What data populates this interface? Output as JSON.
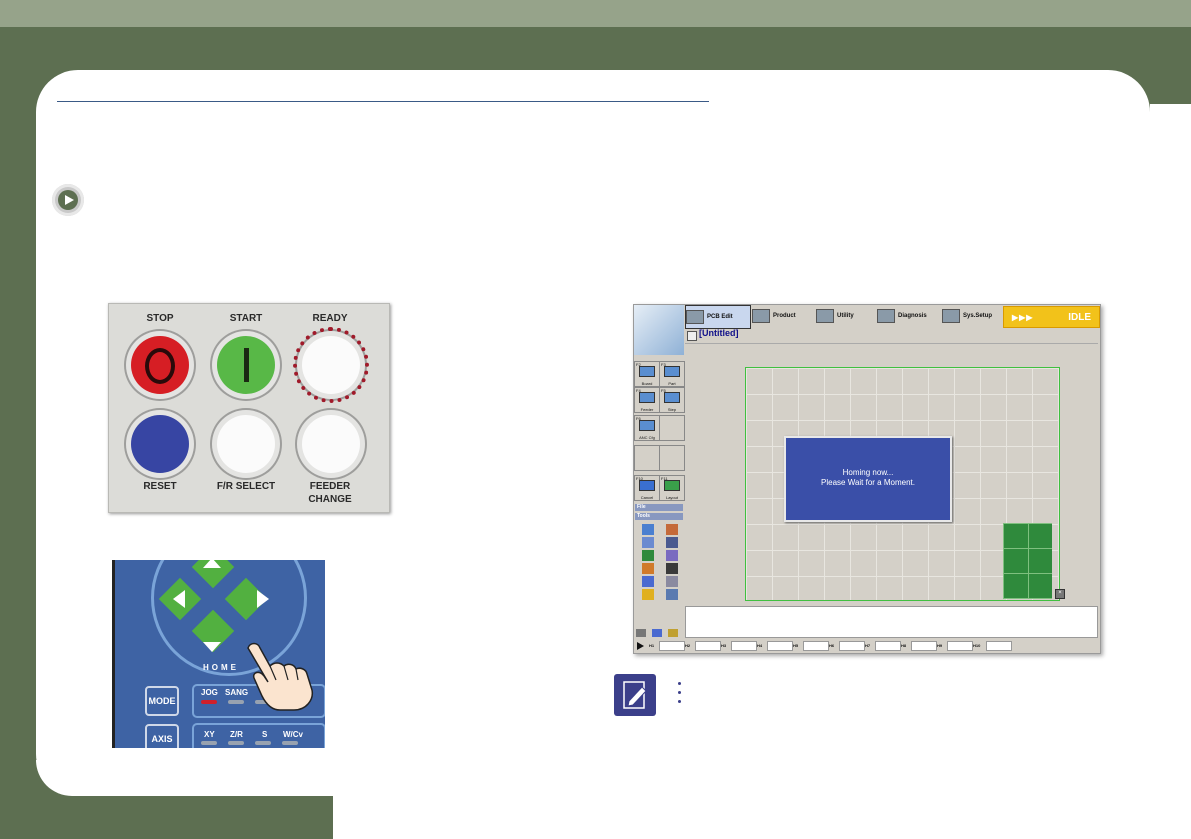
{
  "panel": {
    "stop_label": "STOP",
    "start_label": "START",
    "ready_label": "READY",
    "reset_label": "RESET",
    "fr_select_label": "F/R  SELECT",
    "feeder_change_label_1": "FEEDER",
    "feeder_change_label_2": "CHANGE",
    "stop_glyph": "O",
    "start_glyph": "|"
  },
  "keypad": {
    "home_label": "HOME",
    "mode_label": "MODE",
    "axis_label": "AXIS",
    "jog_label": "JOG",
    "sang_label": "SANG",
    "xy_label": "XY",
    "zr_label": "Z/R",
    "s_label": "S",
    "wcv_label": "W/Cv"
  },
  "screen": {
    "tabs": [
      {
        "label": "PCB Edit"
      },
      {
        "label": "Product"
      },
      {
        "label": "Utility"
      },
      {
        "label": "Diagnosis"
      },
      {
        "label": "Sys.Setup"
      }
    ],
    "status_text": "IDLE",
    "status_arrows": "▶▶▶",
    "doc_title": "[Untitled]",
    "side": {
      "board_key": "F2",
      "board_label": "Board",
      "part_key": "F3",
      "part_label": "Part",
      "feeder_key": "F4",
      "feeder_label": "Feeder",
      "step_key": "F5",
      "step_label": "Step",
      "anc_key": "F6",
      "anc_label": "ANC Cfg",
      "cancel_key": "F10",
      "cancel_label": "Cancel",
      "layout_key": "F11",
      "layout_label": "Layout",
      "file_section": "File",
      "tools_section": "Tools"
    },
    "dialog_line1": "Homing now...",
    "dialog_line2": "Please Wait for a Moment.",
    "hotkeys": [
      "H1",
      "H2",
      "H3",
      "H4",
      "H5",
      "H6",
      "H7",
      "H8",
      "H9",
      "H10"
    ]
  },
  "colors": {
    "frame_green": "#5d6f51",
    "top_strip": "#96a38a",
    "status_yellow": "#f2c21a",
    "dialog_blue": "#3a4fa8",
    "note_blue": "#3b3f8a",
    "ready_ring": "#a01a2a"
  }
}
